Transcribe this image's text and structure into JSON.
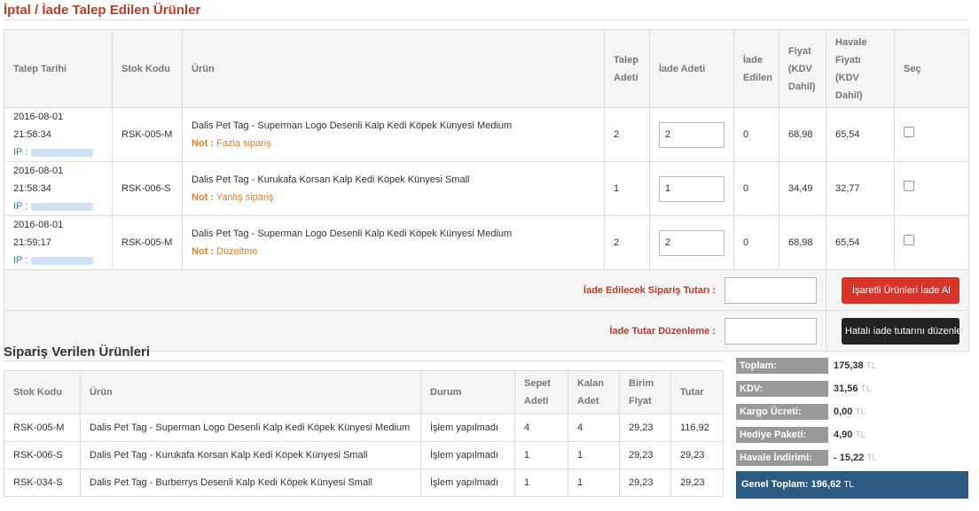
{
  "returns": {
    "title": "İptal / İade Talep Edilen Ürünler",
    "headers": {
      "date": "Talep Tarihi",
      "sku": "Stok Kodu",
      "product": "Ürün",
      "req_qty": "Talep Adeti",
      "return_qty": "İade Adeti",
      "returned": "İade Edilen",
      "price": "Fiyat (KDV Dahil)",
      "transfer_price": "Havale Fiyatı (KDV Dahil)",
      "select": "Seç"
    },
    "ip_label": "IP :",
    "note_label": "Not :",
    "rows": [
      {
        "date": "2016-08-01 21:58:34",
        "sku": "RSK-005-M",
        "product": "Dalis Pet Tag - Superman Logo Desenli Kalp Kedi Köpek Künyesi Medium",
        "note": "Fazla sipariş",
        "req_qty": "2",
        "return_qty": "2",
        "returned": "0",
        "price": "68,98",
        "transfer_price": "65,54"
      },
      {
        "date": "2016-08-01 21:58:34",
        "sku": "RSK-006-S",
        "product": "Dalis Pet Tag - Kurukafa Korsan Kalp Kedi Köpek Künyesi Small",
        "note": "Yanlış sipariş",
        "req_qty": "1",
        "return_qty": "1",
        "returned": "0",
        "price": "34,49",
        "transfer_price": "32,77"
      },
      {
        "date": "2016-08-01 21:59:17",
        "sku": "RSK-005-M",
        "product": "Dalis Pet Tag - Superman Logo Desenli Kalp Kedi Köpek Künyesi Medium",
        "note": "Düzeltme",
        "req_qty": "2",
        "return_qty": "2",
        "returned": "0",
        "price": "68,98",
        "transfer_price": "65,54"
      }
    ],
    "refund_amount_label": "İade Edilecek Sipariş Tutarı :",
    "refund_button": "İşaretli Ürünleri İade Al",
    "adjust_label": "İade Tutar Düzenleme :",
    "adjust_button": "Hatalı iade tutarını düzenle"
  },
  "order": {
    "title": "Sipariş Verilen Ürünleri",
    "headers": {
      "sku": "Stok Kodu",
      "product": "Ürün",
      "status": "Durum",
      "cart_qty": "Sepet Adeti",
      "remaining": "Kalan Adet",
      "unit_price": "Birim Fiyat",
      "total": "Tutar"
    },
    "rows": [
      {
        "sku": "RSK-005-M",
        "product": "Dalis Pet Tag - Superman Logo Desenli Kalp Kedi Köpek Künyesi Medium",
        "status": "İşlem yapılmadı",
        "cart_qty": "4",
        "remaining": "4",
        "unit_price": "29,23",
        "total": "116,92"
      },
      {
        "sku": "RSK-006-S",
        "product": "Dalis Pet Tag - Kurukafa Korsan Kalp Kedi Köpek Künyesi Small",
        "status": "İşlem yapılmadı",
        "cart_qty": "1",
        "remaining": "1",
        "unit_price": "29,23",
        "total": "29,23"
      },
      {
        "sku": "RSK-034-S",
        "product": "Dalis Pet Tag - Burberrys Desenli Kalp Kedi Köpek Künyesi Small",
        "status": "İşlem yapılmadı",
        "cart_qty": "1",
        "remaining": "1",
        "unit_price": "29,23",
        "total": "29,23"
      }
    ]
  },
  "totals": {
    "currency": "TL",
    "items": [
      {
        "label": "Toplam:",
        "value": "175,38"
      },
      {
        "label": "KDV:",
        "value": "31,56"
      },
      {
        "label": "Kargo Ücreti:",
        "value": "0,00"
      },
      {
        "label": "Hediye Paketi:",
        "value": "4,90"
      },
      {
        "label": "Havale İndirimi:",
        "value": "- 15,22"
      }
    ],
    "grand_label": "Genel Toplam:",
    "grand_value": "196,62"
  }
}
